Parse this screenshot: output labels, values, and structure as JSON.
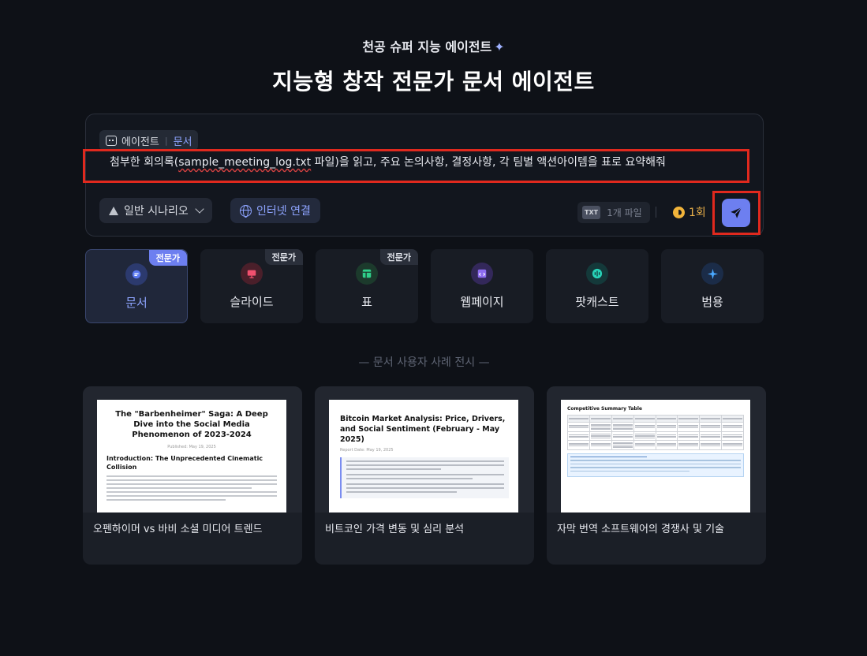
{
  "header": {
    "subtitle": "천공 슈퍼 지능 에이전트",
    "title": "지능형 창작 전문가 문서 에이전트"
  },
  "composer": {
    "agent_label": "에이전트",
    "agent_type": "문서",
    "prompt_before": "첨부한 회의록(",
    "prompt_file": "sample_meeting_log.txt",
    "prompt_after": " 파일)을 읽고, 주요 논의사항, 결정사항, 각 팀별 액션아이템을 표로 요약해줘",
    "scenario_label": "일반 시나리오",
    "internet_label": "인터넷 연결",
    "file_badge": "TXT",
    "file_count": "1개 파일",
    "credits": "1회"
  },
  "agents": [
    {
      "label": "문서",
      "badge": "전문가",
      "icon": "document-icon"
    },
    {
      "label": "슬라이드",
      "badge": "전문가",
      "icon": "slide-icon"
    },
    {
      "label": "표",
      "badge": "전문가",
      "icon": "table-icon"
    },
    {
      "label": "웹페이지",
      "badge": "",
      "icon": "webpage-icon"
    },
    {
      "label": "팟캐스트",
      "badge": "",
      "icon": "podcast-icon"
    },
    {
      "label": "범용",
      "badge": "",
      "icon": "sparkle-icon"
    }
  ],
  "showcase": {
    "heading": "— 문서 사용자 사례 전시 —",
    "cases": [
      {
        "caption": "오펜하이머 vs 바비 소셜 미디어 트렌드",
        "doc_title": "The \"Barbenheimer\" Saga: A Deep Dive into the Social Media Phenomenon of 2023-2024",
        "doc_date": "Published: May 19, 2025",
        "doc_heading": "Introduction: The Unprecedented Cinematic Collision"
      },
      {
        "caption": "비트코인 가격 변동 및 심리 분석",
        "doc_title": "Bitcoin Market Analysis: Price, Drivers, and Social Sentiment (February - May 2025)",
        "doc_date": "Report Date: May 19, 2025"
      },
      {
        "caption": "자막 번역 소프트웨어의 경쟁사 및 기술",
        "doc_title": "Competitive Summary Table"
      }
    ]
  },
  "colors": {
    "background": "#0e1117",
    "accent": "#6d7ff0",
    "accent_text": "#8ea4ff",
    "highlight_box": "#e0291e",
    "credit": "#e9b04a"
  }
}
